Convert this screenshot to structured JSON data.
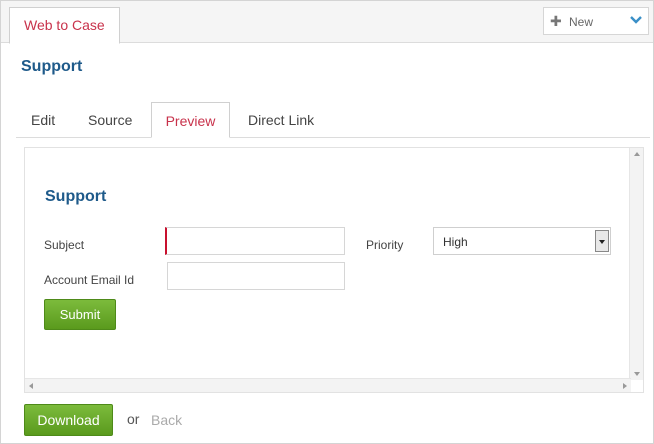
{
  "header": {
    "active_tab": "Web to Case",
    "new_button": {
      "label": "New",
      "icon": "plus-icon",
      "chevron": "chevron-down-icon"
    }
  },
  "page": {
    "title": "Support"
  },
  "tabs": [
    {
      "label": "Edit"
    },
    {
      "label": "Source"
    },
    {
      "label": "Preview",
      "active": true
    },
    {
      "label": "Direct Link"
    }
  ],
  "form": {
    "title": "Support",
    "subject": {
      "label": "Subject",
      "value": ""
    },
    "email": {
      "label": "Account Email Id",
      "value": ""
    },
    "priority": {
      "label": "Priority",
      "selected": "High"
    },
    "submit_label": "Submit"
  },
  "footer": {
    "download_label": "Download",
    "or_text": "or",
    "back_label": "Back"
  },
  "colors": {
    "accent_red": "#c8324b",
    "title_blue": "#1e5a8a",
    "button_green": "#6aab2a"
  }
}
